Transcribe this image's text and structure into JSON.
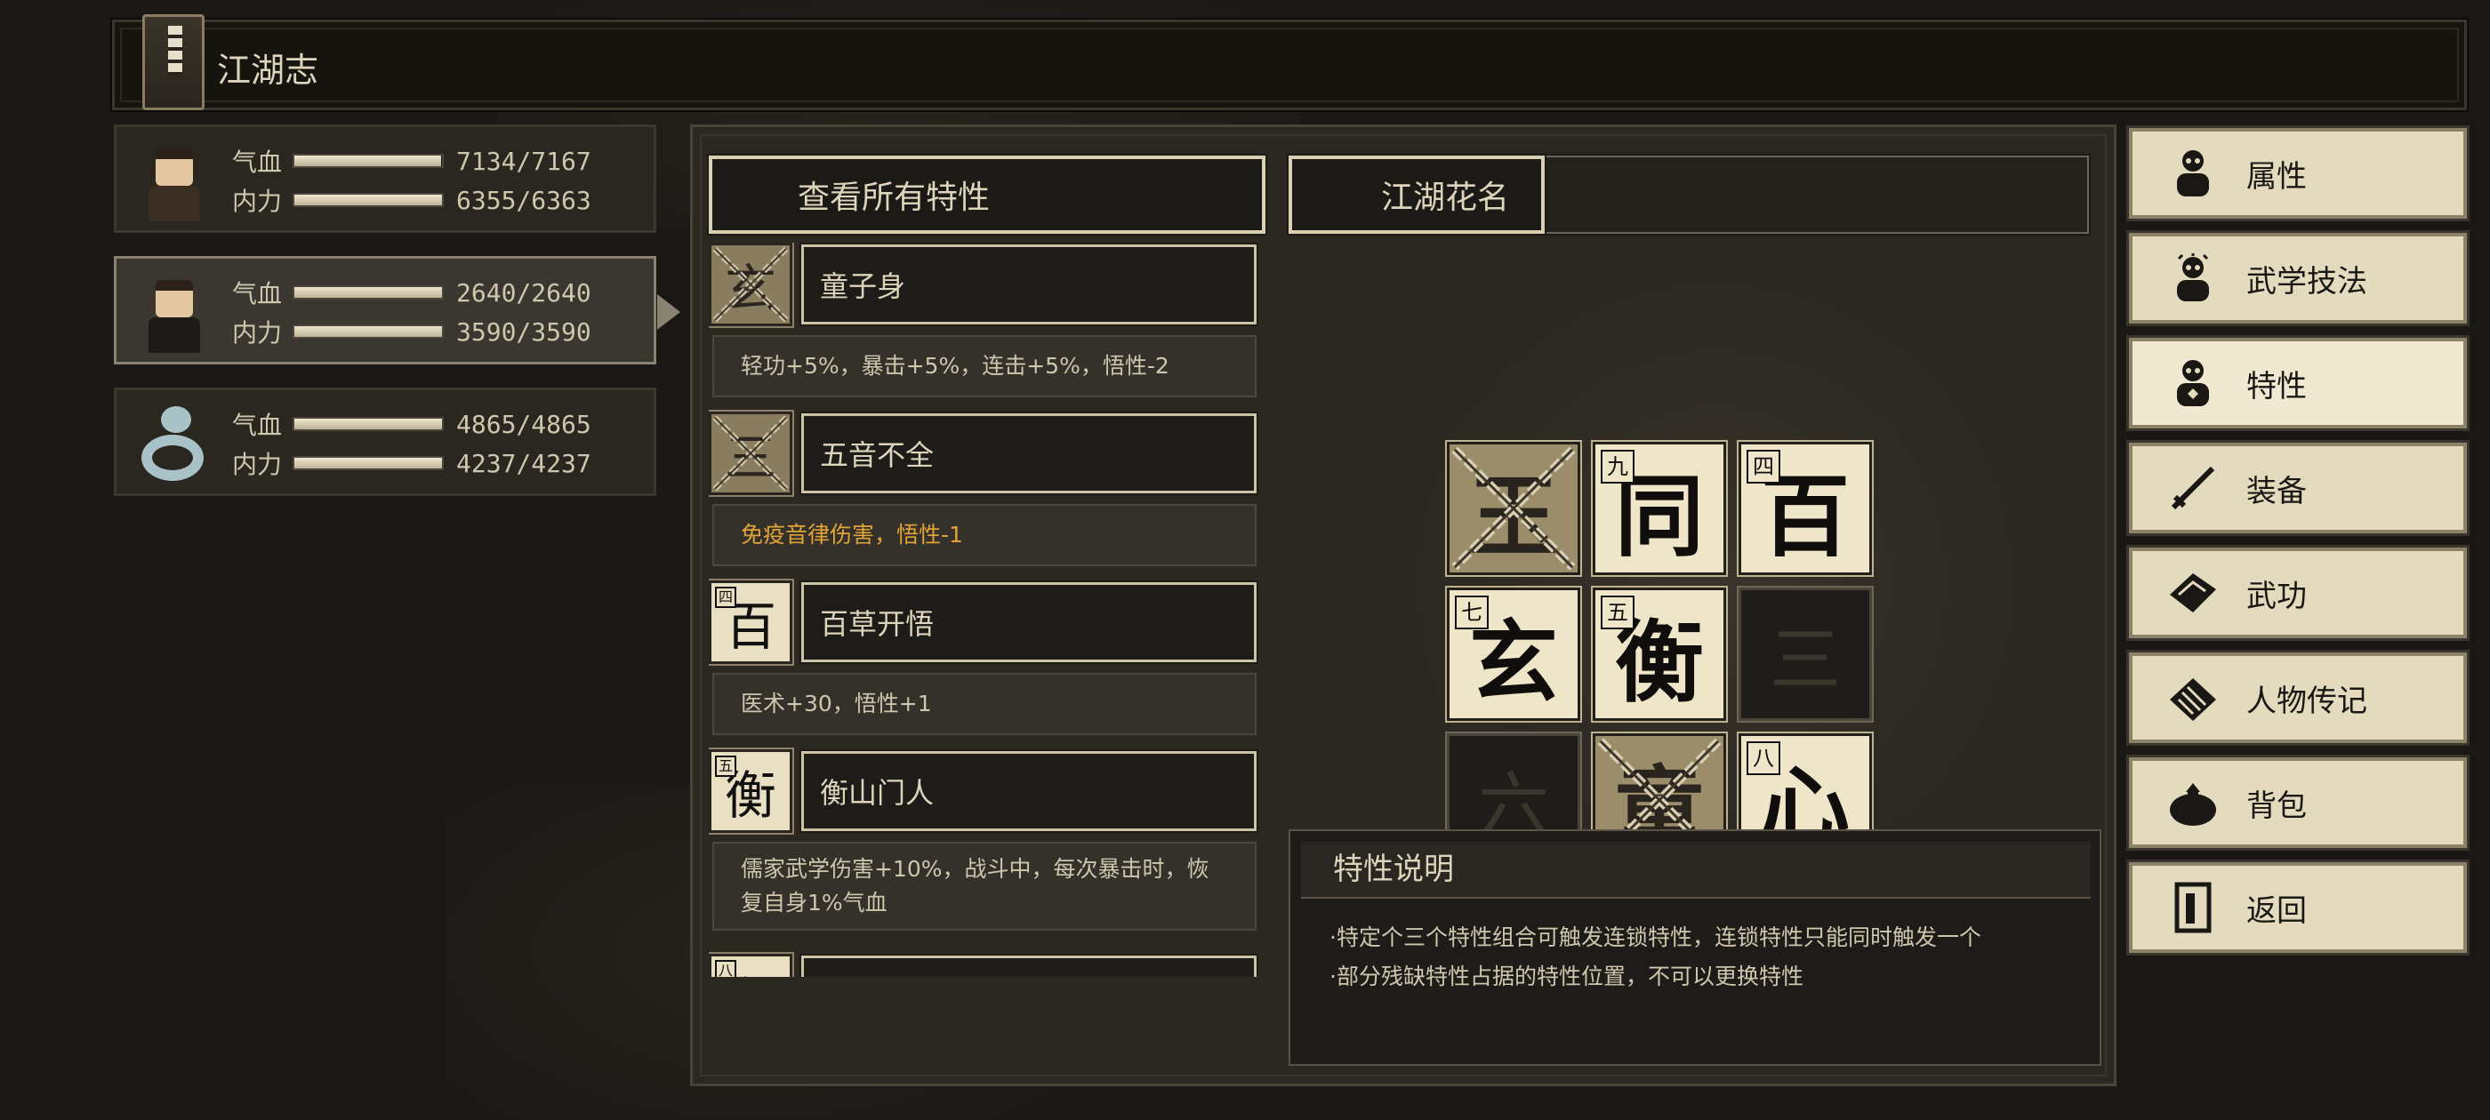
{
  "header": {
    "title": "江湖志"
  },
  "characters": [
    {
      "hp_label": "气血",
      "hp": "7134/7167",
      "hp_fill": 0.995,
      "mp_label": "内力",
      "mp": "6355/6363",
      "mp_fill": 0.999,
      "avatar": "swordsman-avatar"
    },
    {
      "hp_label": "气血",
      "hp": "2640/2640",
      "hp_fill": 1.0,
      "mp_label": "内力",
      "mp": "3590/3590",
      "mp_fill": 1.0,
      "avatar": "girl-avatar"
    },
    {
      "hp_label": "气血",
      "hp": "4865/4865",
      "hp_fill": 1.0,
      "mp_label": "内力",
      "mp": "4237/4237",
      "mp_fill": 1.0,
      "avatar": "snake-avatar"
    }
  ],
  "tabs": {
    "all_traits": "查看所有特性",
    "nickname": "江湖花名"
  },
  "traits": [
    {
      "glyph": "玄",
      "name": "童子身",
      "desc": "轻功+5%，暴击+5%，连击+5%，悟性-2",
      "locked": true,
      "warn": false
    },
    {
      "glyph": "三",
      "name": "五音不全",
      "desc": "免疫音律伤害，悟性-1",
      "locked": true,
      "warn": true
    },
    {
      "glyph": "百",
      "mini": "四",
      "name": "百草开悟",
      "desc": "医术+30，悟性+1",
      "locked": false,
      "warn": false
    },
    {
      "glyph": "衡",
      "mini": "五",
      "name": "衡山门人",
      "desc": "儒家武学伤害+10%，战斗中，每次暴击时，恢复自身1%气血",
      "locked": false,
      "warn": false
    },
    {
      "glyph": "心",
      "mini": "八",
      "name": "",
      "desc": "",
      "locked": false,
      "warn": false
    }
  ],
  "grid": [
    {
      "glyph": "玉",
      "mini": "",
      "state": "locked"
    },
    {
      "glyph": "同",
      "mini": "九",
      "state": "normal"
    },
    {
      "glyph": "百",
      "mini": "四",
      "state": "normal"
    },
    {
      "glyph": "玄",
      "mini": "七",
      "state": "normal"
    },
    {
      "glyph": "衡",
      "mini": "五",
      "state": "normal"
    },
    {
      "glyph": "三",
      "mini": "",
      "state": "empty"
    },
    {
      "glyph": "六",
      "mini": "",
      "state": "empty"
    },
    {
      "glyph": "童",
      "mini": "",
      "state": "locked"
    },
    {
      "glyph": "心",
      "mini": "八",
      "state": "normal"
    }
  ],
  "description": {
    "title": "特性说明",
    "lines": [
      "·特定个三个特性组合可触发连锁特性，连锁特性只能同时触发一个",
      "·部分残缺特性占据的特性位置，不可以更换特性"
    ]
  },
  "menu": [
    {
      "label": "属性",
      "icon": "character-icon",
      "selected": false
    },
    {
      "label": "武学技法",
      "icon": "martial-skill-icon",
      "selected": false
    },
    {
      "label": "特性",
      "icon": "trait-icon",
      "selected": true
    },
    {
      "label": "装备",
      "icon": "sword-icon",
      "selected": false
    },
    {
      "label": "武功",
      "icon": "book-icon",
      "selected": false
    },
    {
      "label": "人物传记",
      "icon": "scroll-icon",
      "selected": false
    },
    {
      "label": "背包",
      "icon": "bag-icon",
      "selected": false
    },
    {
      "label": "返回",
      "icon": "door-icon",
      "selected": false
    }
  ],
  "colors": {
    "accent": "#e2a437",
    "panel": "#2b2822",
    "paper": "#e9dfc2"
  }
}
